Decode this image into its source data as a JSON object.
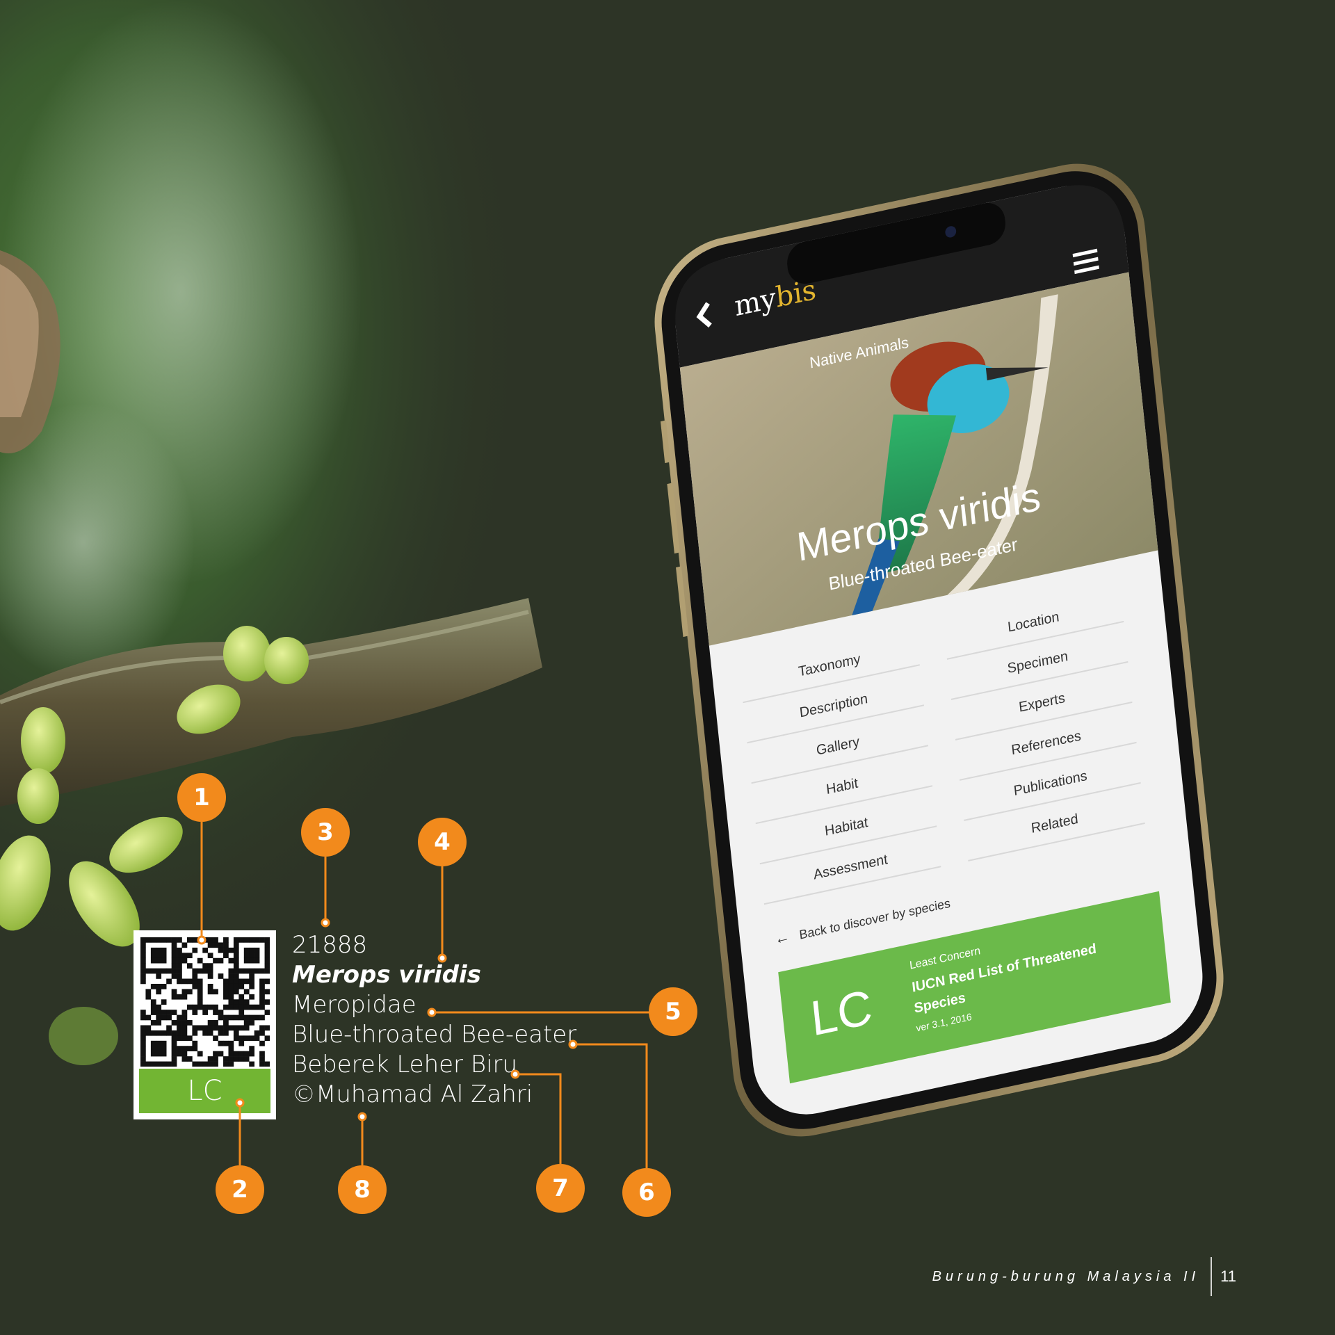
{
  "page": {
    "footer_title": "Burung-burung Malaysia II",
    "page_number": "11"
  },
  "label_card": {
    "status_code": "LC",
    "record_id": "21888",
    "scientific_name": "Merops viridis",
    "family": "Meropidae",
    "english_name": "Blue-throated Bee-eater",
    "malay_name": "Beberek Leher Biru",
    "credit": "©Muhamad Al Zahri"
  },
  "callouts": [
    "1",
    "2",
    "3",
    "4",
    "5",
    "6",
    "7",
    "8"
  ],
  "phone": {
    "app_name_part1": "my",
    "app_name_part2": "bis",
    "hero": {
      "category": "Native Animals",
      "scientific_name": "Merops viridis",
      "common_name": "Blue-throated Bee-eater"
    },
    "menu": {
      "left": [
        "Taxonomy",
        "Description",
        "Gallery",
        "Habit",
        "Habitat",
        "Assessment"
      ],
      "right": [
        "Location",
        "Specimen",
        "Experts",
        "References",
        "Publications",
        "Related"
      ]
    },
    "back_link": "Back to discover by species",
    "status_card": {
      "code": "LC",
      "label": "Least Concern",
      "list_name_line1": "IUCN Red List of Threatened",
      "list_name_line2": "Species",
      "version": "ver 3.1, 2016"
    }
  },
  "colors": {
    "background": "#2d3426",
    "accent_orange": "#f28a1c",
    "status_green": "#72b533",
    "phone_frame": "#9c8a5e"
  }
}
